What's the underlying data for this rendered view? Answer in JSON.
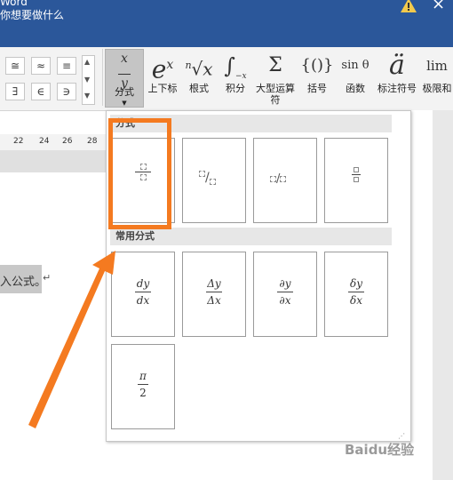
{
  "window": {
    "title_fragment": "Word",
    "tell_me_fragment": "你想要做什么"
  },
  "ribbon": {
    "symbols": [
      "≅",
      "≈",
      "≡",
      "∃",
      "∈",
      "∋"
    ],
    "buttons": [
      {
        "id": "fraction",
        "label": "分式",
        "icon": "x/y"
      },
      {
        "id": "script",
        "label": "上下标",
        "icon": "eˣ"
      },
      {
        "id": "radical",
        "label": "根式",
        "icon": "ⁿ√x"
      },
      {
        "id": "integral",
        "label": "积分",
        "icon": "∫"
      },
      {
        "id": "large-operator",
        "label": "大型运算符",
        "icon": "Σ"
      },
      {
        "id": "bracket",
        "label": "括号",
        "icon": "{()}"
      },
      {
        "id": "function",
        "label": "函数",
        "icon": "sin θ"
      },
      {
        "id": "accent",
        "label": "标注符号",
        "icon": "ä"
      },
      {
        "id": "limit-log",
        "label": "极限和",
        "icon": "lim"
      }
    ]
  },
  "ruler": {
    "ticks": [
      "22",
      "24",
      "26",
      "28"
    ]
  },
  "document": {
    "selected_text": "入公式。",
    "paragraph_mark": "↵"
  },
  "gallery": {
    "section1_title": "分式",
    "section2_title": "常用分式",
    "common": {
      "dy_dx": {
        "num": "dy",
        "den": "dx"
      },
      "Dy_Dx": {
        "num": "Δy",
        "den": "Δx"
      },
      "py_px": {
        "num": "∂y",
        "den": "∂x"
      },
      "dly_dlx": {
        "num": "δy",
        "den": "δx"
      },
      "pi_2": {
        "num": "π",
        "den": "2"
      }
    }
  },
  "watermark": "Baidu经验",
  "colors": {
    "title_bar": "#2b579a",
    "highlight": "#f47a20"
  }
}
